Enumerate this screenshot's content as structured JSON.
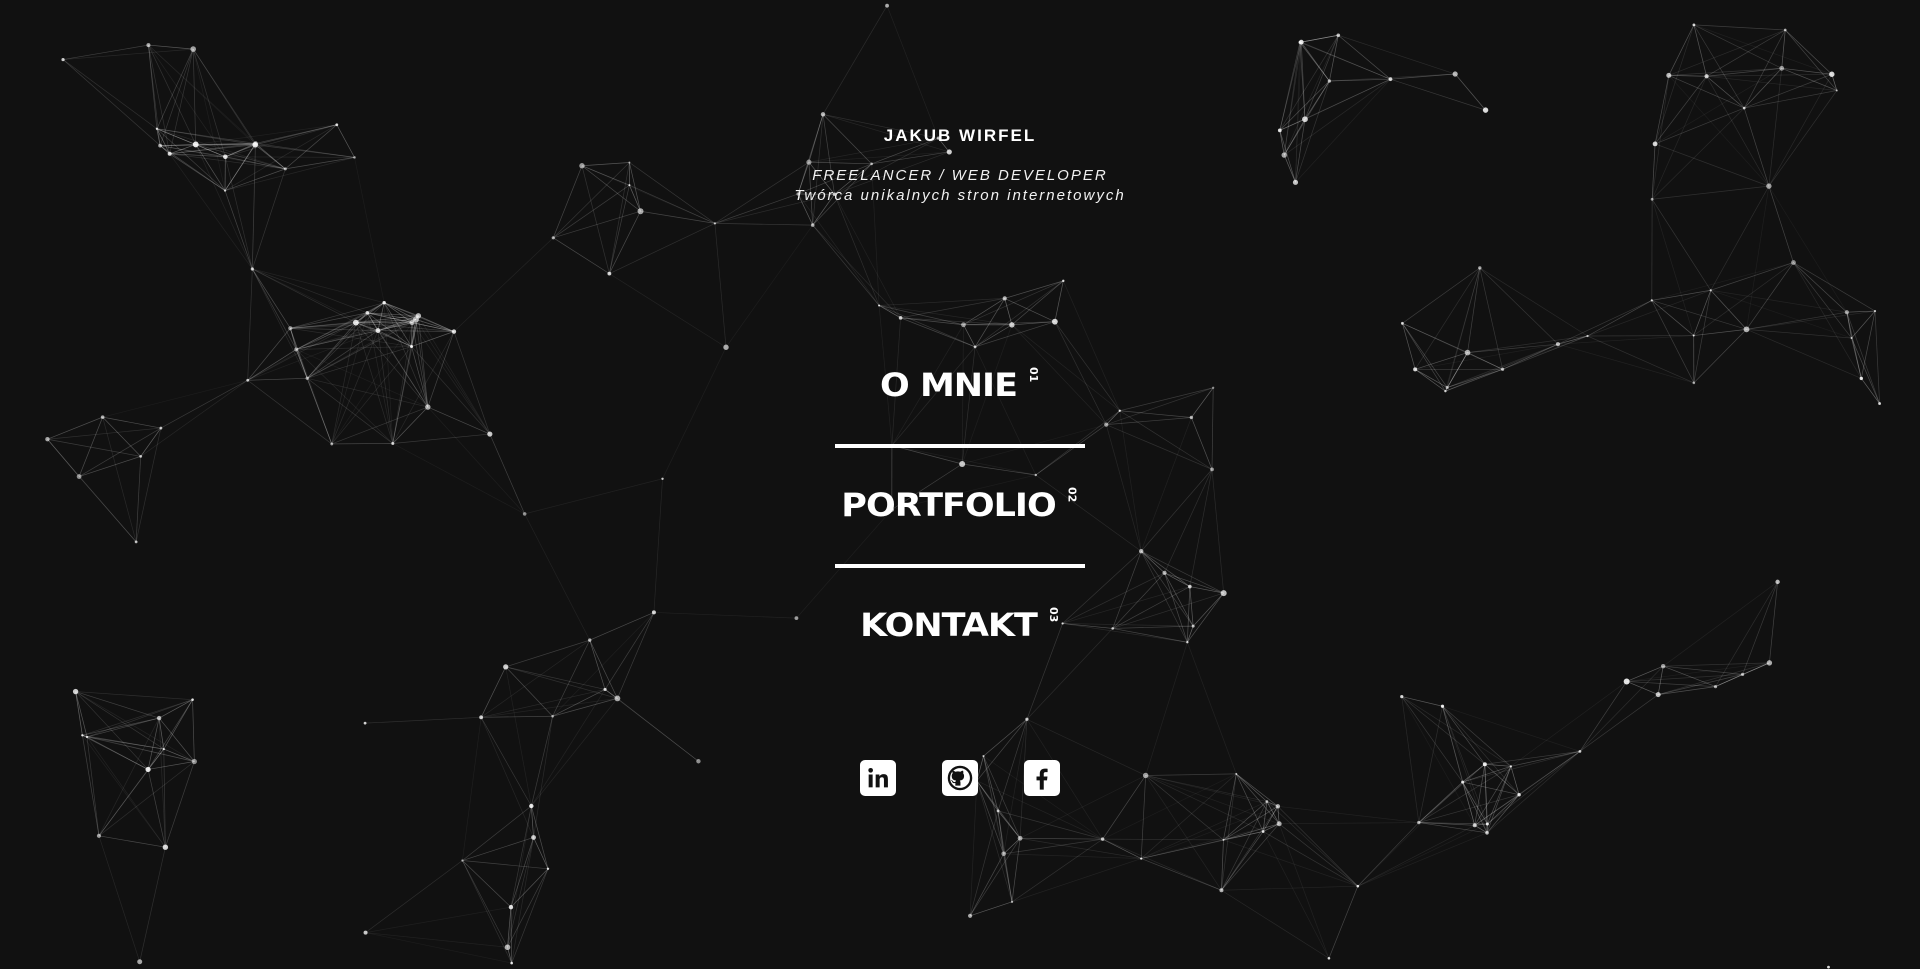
{
  "header": {
    "name": "JAKUB WIRFEL",
    "role": "FREELANCER / WEB DEVELOPER",
    "tagline": "Twórca unikalnych stron internetowych"
  },
  "nav": {
    "items": [
      {
        "label": "O MNIE",
        "number": "01"
      },
      {
        "label": "PORTFOLIO",
        "number": "02"
      },
      {
        "label": "KONTAKT",
        "number": "03"
      }
    ]
  },
  "social": {
    "links": [
      {
        "icon": "linkedin-icon"
      },
      {
        "icon": "github-icon"
      },
      {
        "icon": "facebook-icon"
      }
    ]
  },
  "theme": {
    "background": "#111111",
    "foreground": "#ffffff"
  }
}
